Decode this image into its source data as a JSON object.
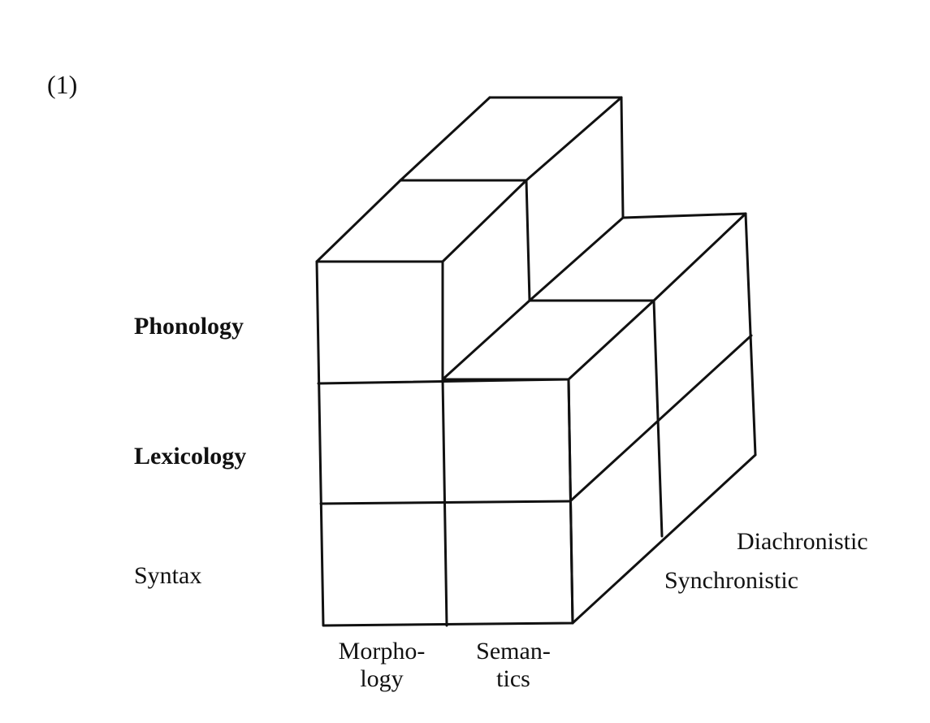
{
  "figure": {
    "number": "(1)"
  },
  "rows": {
    "phonology": "Phonology",
    "lexicology": "Lexicology",
    "syntax": "Syntax"
  },
  "columns": {
    "morphology_line1": "Morpho-",
    "morphology_line2": "logy",
    "semantics_line1": "Seman-",
    "semantics_line2": "tics"
  },
  "depth": {
    "diachronistic": "Diachronistic",
    "synchronistic": "Synchronistic"
  },
  "style": {
    "line_color": "#111111",
    "background": "#ffffff"
  }
}
